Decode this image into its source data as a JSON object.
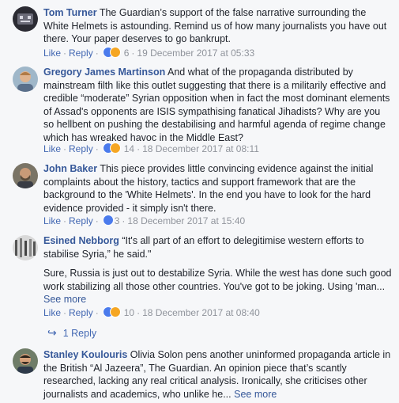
{
  "comments": [
    {
      "author": "Tom Turner",
      "text": "The Guardian’s support of the false narrative surrounding the White Helmets is astounding. Remind us of how many journalists you have out there. Your paper deserves to go bankrupt.",
      "like": "Like",
      "reply": "Reply",
      "reactions": "6",
      "time": "19 December 2017 at 05:33"
    },
    {
      "author": "Gregory James Martinson",
      "text": "And what of the propaganda distributed by mainstream filth like this outlet suggesting that there is a militarily effective and credible “moderate” Syrian opposition when in fact the most dominant elements of Assad's opponents are ISIS sympathising fanatical Jihadists? Why are you so hellbent on pushing the destabilising and harmful agenda of regime change which has wreaked havoc in the Middle East?",
      "like": "Like",
      "reply": "Reply",
      "reactions": "14",
      "time": "18 December 2017 at 08:11"
    },
    {
      "author": "John Baker",
      "text": "This piece provides little convincing evidence against the initial complaints about the history, tactics and support framework that are the background to the 'White Helmets'. In the end you have to look for the hard evidence provided - it simply isn't there.",
      "like": "Like",
      "reply": "Reply",
      "reactions": "3",
      "time": "18 December 2017 at 15:40"
    },
    {
      "author": "Esined Nebborg",
      "text": "“It's all part of an effort to delegitimise western efforts to stabilise Syria,” he said.\"",
      "text2": "Sure, Russia is just out to destabilize Syria. While the west has done such good work stabilizing all those other countries. You've got to be joking. Using 'man...",
      "see_more": "See more",
      "like": "Like",
      "reply": "Reply",
      "reactions": "10",
      "time": "18 December 2017 at 08:40",
      "replies_label": "1 Reply"
    },
    {
      "author": "Stanley Koulouris",
      "text": "Olivia Solon pens another uninformed propaganda article in the British “Al Jazeera”, The Guardian. An opinion piece that’s scantly researched, lacking any real critical analysis. Ironically, she criticises other journalists and academics, who unlike he...",
      "see_more": "See more"
    }
  ],
  "colors": {
    "name": "#365899",
    "link": "#4267b2",
    "meta": "#90949c",
    "like_reaction": "#4b7bec",
    "angry_reaction": "#f5a623"
  }
}
